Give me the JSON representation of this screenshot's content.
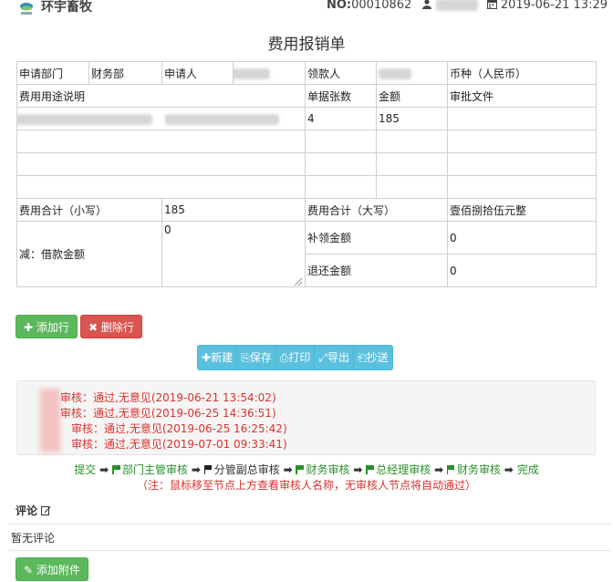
{
  "header": {
    "company": "环宇畜牧",
    "no_label": "NO:",
    "no_value": "00010862",
    "date": "2019-06-21 13:29"
  },
  "form": {
    "title": "费用报销单",
    "dept_label": "申请部门",
    "dept_value": "财务部",
    "applicant_label": "申请人",
    "payee_label": "领款人",
    "currency_label": "币种（人民币）",
    "purpose_label": "费用用途说明",
    "doc_count_label": "单据张数",
    "amount_label": "金额",
    "approval_docs_label": "审批文件",
    "row1_count": "4",
    "row1_amount": "185",
    "total_small_label": "费用合计（小写）",
    "total_small_value": "185",
    "total_big_label": "费用合计（大写）",
    "total_big_value": "壹佰捌拾伍元整",
    "loan_label": "减：借款金额",
    "loan_value": "0",
    "supplement_label": "补领金额",
    "supplement_value": "0",
    "refund_label": "退还金额",
    "refund_value": "0"
  },
  "actions": {
    "add_row": "添加行",
    "delete_row": "删除行",
    "new": "新建",
    "save": "保存",
    "print": "打印",
    "export": "导出",
    "cc": "抄送"
  },
  "log": [
    "审核：通过,无意见(2019-06-21 13:54:02)",
    "审核：通过,无意见(2019-06-25 14:36:51)",
    "审核：通过,无意见(2019-06-25 16:25:42)",
    "审核：通过,无意见(2019-07-01 09:33:41)"
  ],
  "flow": {
    "submit": "提交",
    "step1": "部门主管审核",
    "step2": "分管副总审核",
    "step3": "财务审核",
    "step4": "总经理审核",
    "step5": "财务审核",
    "done": "完成",
    "note": "（注：鼠标移至节点上方查看审核人名称，无审核人节点将自动通过）"
  },
  "comments": {
    "title": "评论",
    "empty": "暂无评论",
    "add_attachment": "添加附件"
  },
  "colors": {
    "accent_green": "#5cb85c",
    "accent_red": "#d9534f",
    "toolbar_blue": "#5bc0de",
    "log_red": "#d9332e",
    "flow_green": "#2a8f2a"
  }
}
